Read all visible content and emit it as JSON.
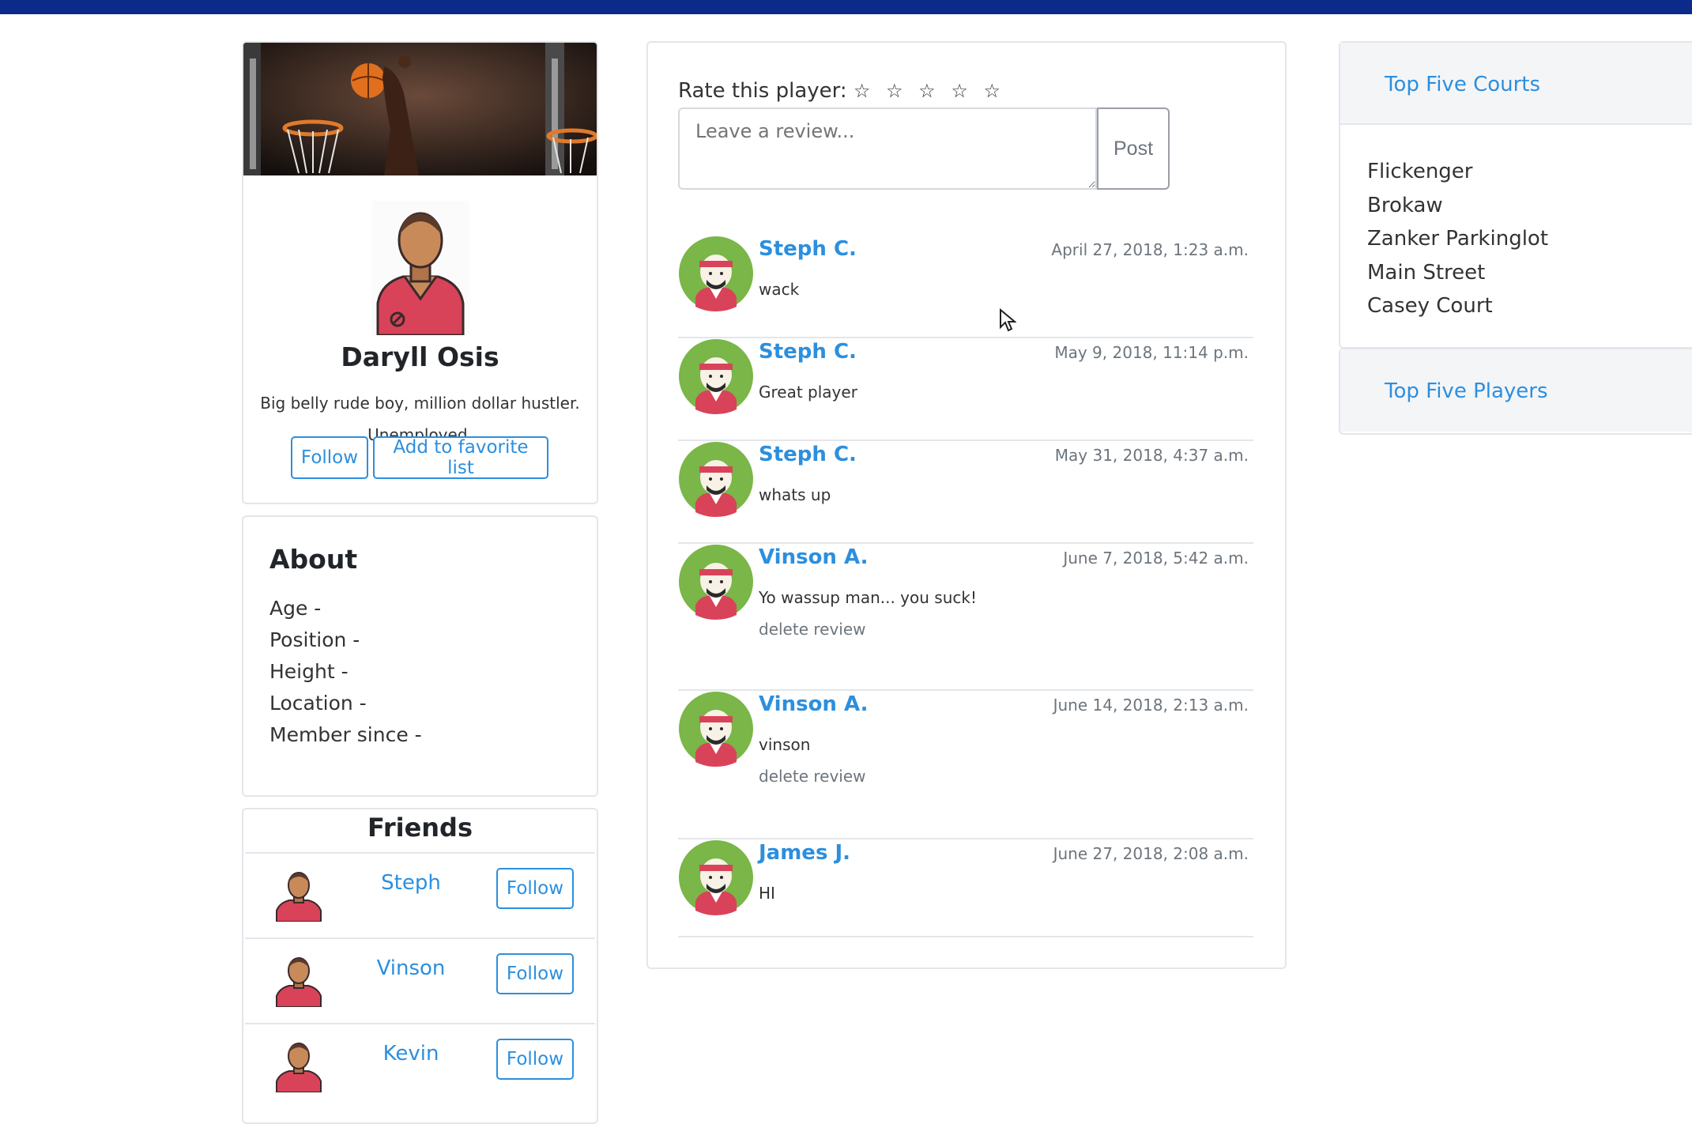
{
  "profile": {
    "name": "Daryll Osis",
    "bio_line1": "Big belly rude boy, million dollar hustler.",
    "bio_line2": "Unemployed.",
    "follow_label": "Follow",
    "favorite_label": "Add to favorite list"
  },
  "about": {
    "title": "About",
    "items": [
      "Age -",
      "Position -",
      "Height -",
      "Location -",
      "Member since -"
    ]
  },
  "friends": {
    "title": "Friends",
    "items": [
      {
        "name": "Steph",
        "follow_label": "Follow"
      },
      {
        "name": "Vinson",
        "follow_label": "Follow"
      },
      {
        "name": "Kevin",
        "follow_label": "Follow"
      }
    ]
  },
  "rating": {
    "label": "Rate this player:",
    "stars": "☆ ☆ ☆ ☆ ☆",
    "review_placeholder": "Leave a review...",
    "post_label": "Post"
  },
  "reviews": [
    {
      "author": "Steph C.",
      "date": "April 27, 2018, 1:23 a.m.",
      "text": "wack",
      "delete": ""
    },
    {
      "author": "Steph C.",
      "date": "May 9, 2018, 11:14 p.m.",
      "text": "Great player",
      "delete": ""
    },
    {
      "author": "Steph C.",
      "date": "May 31, 2018, 4:37 a.m.",
      "text": "whats up",
      "delete": ""
    },
    {
      "author": "Vinson A.",
      "date": "June 7, 2018, 5:42 a.m.",
      "text": "Yo wassup man... you suck!",
      "delete": "delete review"
    },
    {
      "author": "Vinson A.",
      "date": "June 14, 2018, 2:13 a.m.",
      "text": "vinson",
      "delete": "delete review"
    },
    {
      "author": "James J.",
      "date": "June 27, 2018, 2:08 a.m.",
      "text": "HI",
      "delete": ""
    }
  ],
  "courts": {
    "title": "Top Five Courts",
    "items": [
      "Flickenger",
      "Brokaw",
      "Zanker Parkinglot",
      "Main Street",
      "Casey Court"
    ]
  },
  "players": {
    "title": "Top Five Players"
  },
  "colors": {
    "topbar": "#0b2a8a",
    "link": "#2c8fde",
    "avatar_green": "#7ab648",
    "jersey_red": "#d9435a"
  }
}
